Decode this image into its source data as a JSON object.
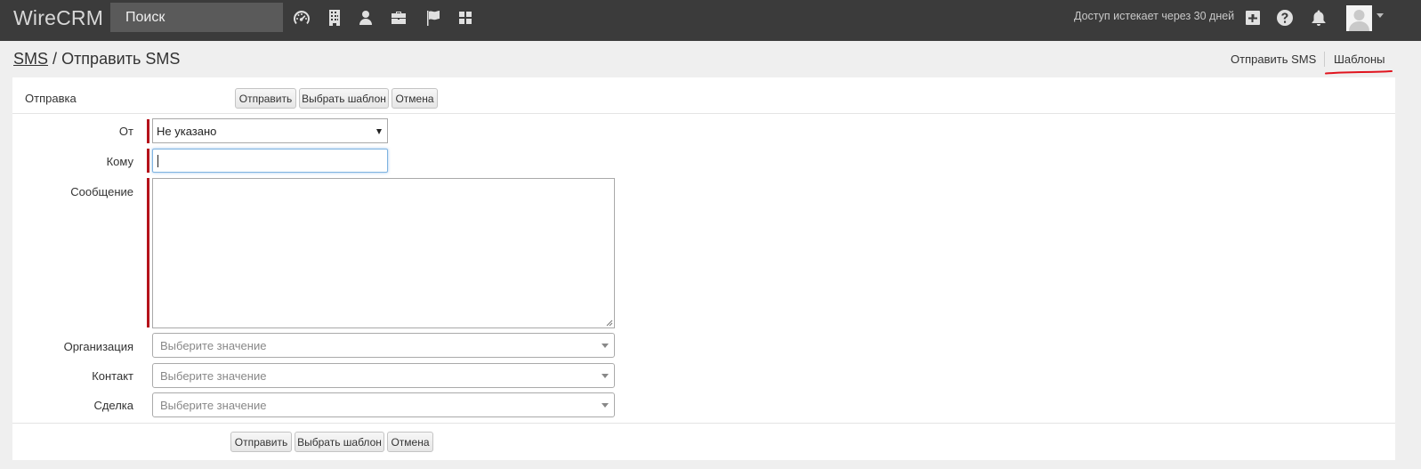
{
  "topbar": {
    "brand": "WireCRM",
    "search_placeholder": "Поиск",
    "access_notice": "Доступ истекает через 30 дней",
    "icons": [
      "dashboard-icon",
      "building-icon",
      "user-icon",
      "briefcase-icon",
      "flag-icon",
      "grid-icon",
      "plus-square-icon",
      "help-icon",
      "bell-icon"
    ]
  },
  "breadcrumb": {
    "parent": "SMS",
    "separator": "/",
    "current": "Отправить SMS"
  },
  "page_actions": {
    "send_sms": "Отправить SMS",
    "templates": "Шаблоны",
    "highlight_color": "#e0141e"
  },
  "form": {
    "section_title": "Отправка",
    "buttons": {
      "send": "Отправить",
      "choose_template": "Выбрать шаблон",
      "cancel": "Отмена"
    },
    "fields": {
      "from_label": "От",
      "from_value": "Не указано",
      "to_label": "Кому",
      "to_value": "",
      "message_label": "Сообщение",
      "message_value": "",
      "organization_label": "Организация",
      "organization_placeholder": "Выберите значение",
      "contact_label": "Контакт",
      "contact_placeholder": "Выберите значение",
      "deal_label": "Сделка",
      "deal_placeholder": "Выберите значение"
    },
    "required_marker_color": "#b5121b"
  }
}
